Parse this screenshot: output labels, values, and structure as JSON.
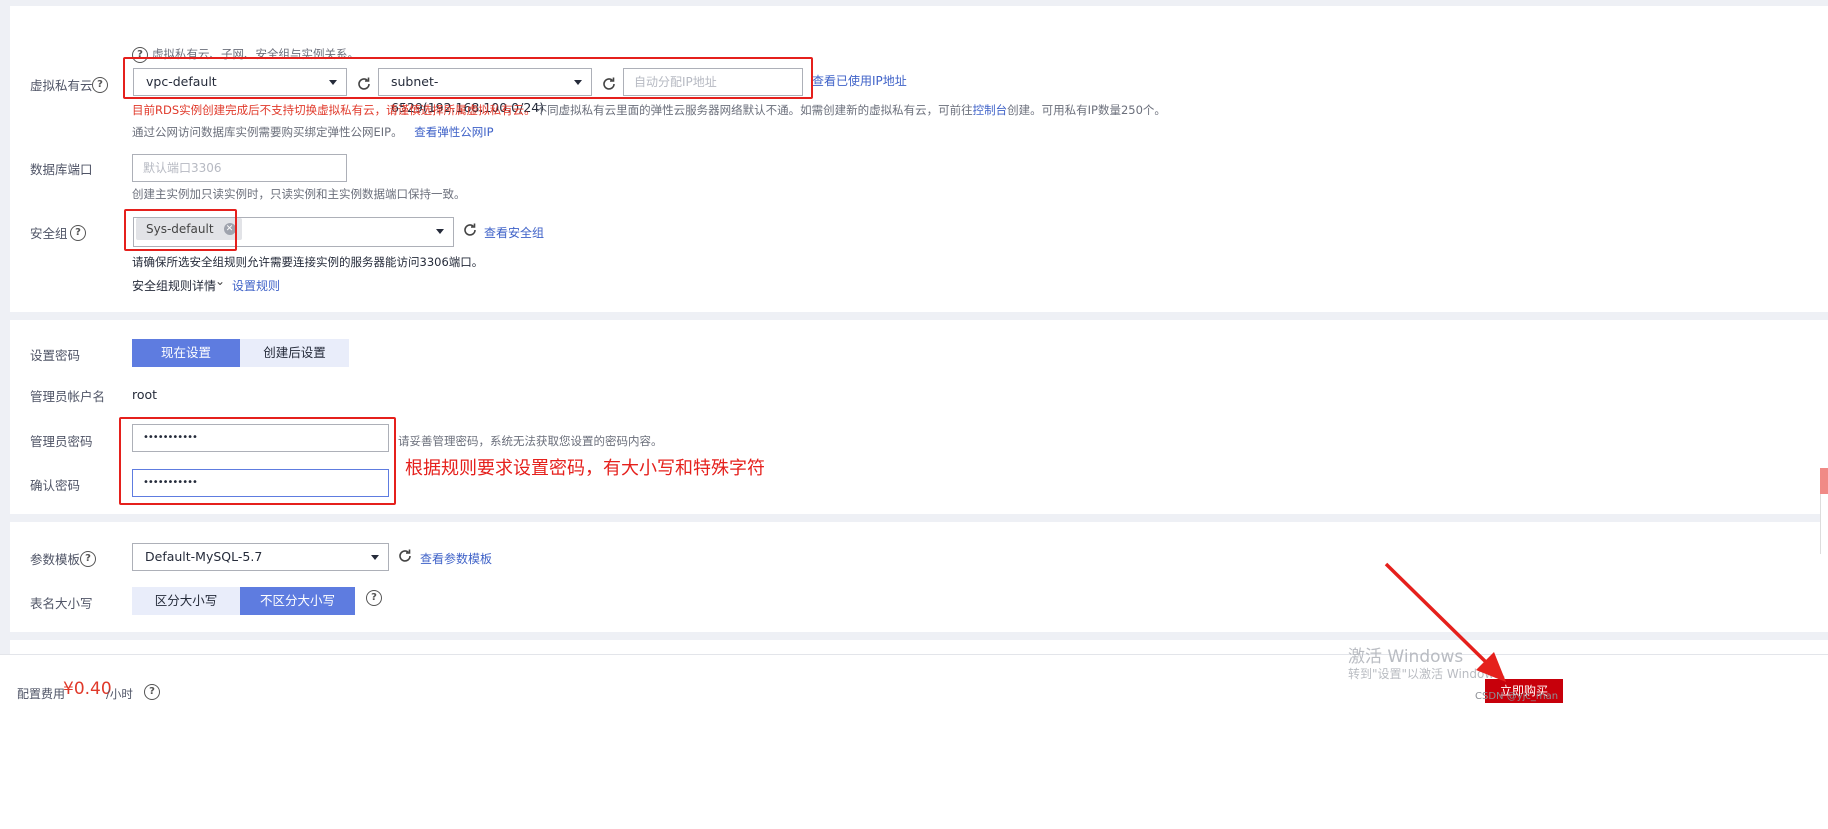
{
  "network": {
    "hint": "虚拟私有云、子网、安全组与实例关系。",
    "vpc_label": "虚拟私有云",
    "vpc_value": "vpc-default",
    "subnet_value": "subnet-6529(192.168.100.0/24)",
    "ip_placeholder": "自动分配IP地址",
    "view_ip_link": "查看已使用IP地址",
    "warning_red": "目前RDS实例创建完成后不支持切换虚拟私有云，请谨慎选择所属虚拟私有云。",
    "warning_gray_1": "不同虚拟私有云里面的弹性云服务器网络默认不通。如需创建新的虚拟私有云，可前往",
    "warning_console_link": "控制台",
    "warning_gray_2": "创建。可用私有IP数量250个。",
    "eip_note": "通过公网访问数据库实例需要购买绑定弹性公网EIP。",
    "eip_link": "查看弹性公网IP",
    "port_label": "数据库端口",
    "port_placeholder": "默认端口3306",
    "port_note": "创建主实例加只读实例时，只读实例和主实例数据端口保持一致。",
    "sg_label": "安全组",
    "sg_tag": "Sys-default",
    "sg_view_link": "查看安全组",
    "sg_note": "请确保所选安全组规则允许需要连接实例的服务器能访问3306端口。",
    "sg_rules_label": "安全组规则详情",
    "sg_rules_link": "设置规则"
  },
  "password": {
    "set_label": "设置密码",
    "set_now": "现在设置",
    "set_later": "创建后设置",
    "admin_label": "管理员帐户名",
    "admin_value": "root",
    "pwd_label": "管理员密码",
    "pwd_value": "•••••••••••",
    "pwd_note": "请妥善管理密码，系统无法获取您设置的密码内容。",
    "confirm_label": "确认密码",
    "confirm_value": "•••••••••••",
    "annotation": "根据规则要求设置密码，有大小写和特殊字符"
  },
  "params": {
    "template_label": "参数模板",
    "template_value": "Default-MySQL-5.7",
    "template_link": "查看参数模板",
    "case_label": "表名大小写",
    "case_sensitive": "区分大小写",
    "case_insensitive": "不区分大小写"
  },
  "footer": {
    "cost_label": "配置费用",
    "cost_value": "¥0.40",
    "cost_unit": "/小时",
    "buy_button": "立即购买",
    "win_title": "激活 Windows",
    "win_sub": "转到\"设置\"以激活 Windows。",
    "watermark": "CSDN @yjc_man"
  },
  "colors": {
    "accent": "#5e7ce0",
    "link": "#3f62c8",
    "annotation_red": "#e5201c",
    "buy": "#c7000b"
  }
}
